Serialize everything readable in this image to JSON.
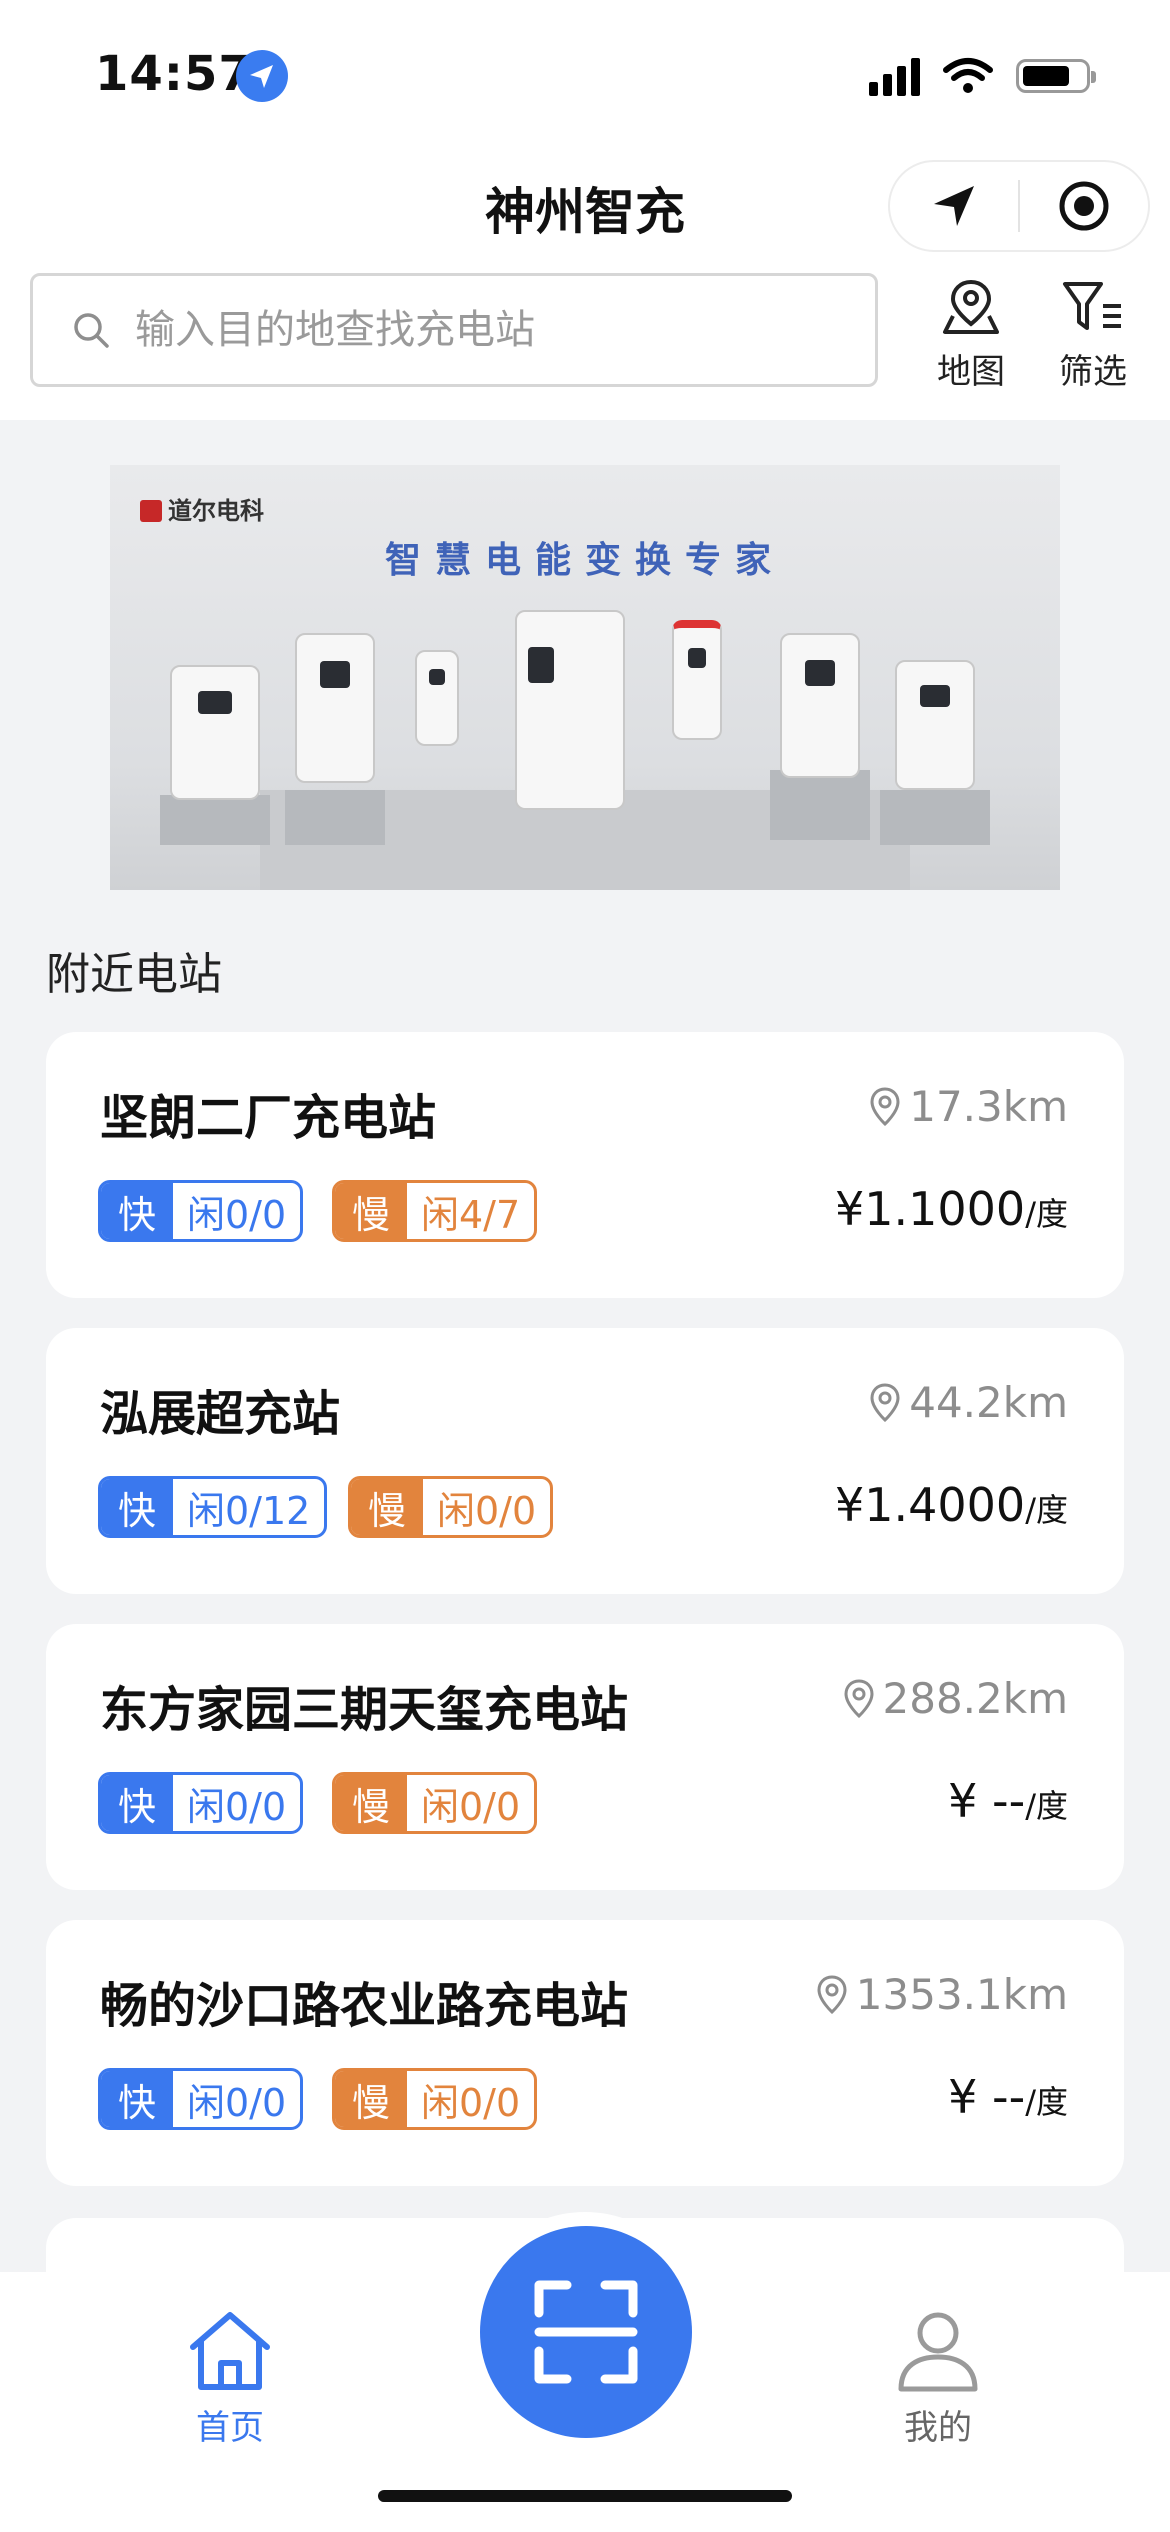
{
  "status_bar": {
    "time": "14:57"
  },
  "header": {
    "title": "神州智充",
    "capsule": {
      "left_icon": "navigation-arrow-icon",
      "right_icon": "target-circle-icon"
    }
  },
  "search": {
    "placeholder": "输入目的地查找充电站",
    "value": ""
  },
  "tools": {
    "map_label": "地图",
    "filter_label": "筛选"
  },
  "banner": {
    "brand": "道尔电科",
    "slogan": "智慧电能变换专家"
  },
  "section_title": "附近电站",
  "stations": [
    {
      "name": "坚朗二厂充电站",
      "distance": "17.3km",
      "fast_key": "快",
      "fast_value": "闲0/0",
      "slow_key": "慢",
      "slow_value": "闲4/7",
      "price": "¥1.1000",
      "unit": "/度"
    },
    {
      "name": "泓展超充站",
      "distance": "44.2km",
      "fast_key": "快",
      "fast_value": "闲0/12",
      "slow_key": "慢",
      "slow_value": "闲0/0",
      "price": "¥1.4000",
      "unit": "/度"
    },
    {
      "name": "东方家园三期天玺充电站",
      "distance": "288.2km",
      "fast_key": "快",
      "fast_value": "闲0/0",
      "slow_key": "慢",
      "slow_value": "闲0/0",
      "price": "¥ --",
      "unit": "/度"
    },
    {
      "name": "畅的沙口路农业路充电站",
      "distance": "1353.1km",
      "fast_key": "快",
      "fast_value": "闲0/0",
      "slow_key": "慢",
      "slow_value": "闲0/0",
      "price": "¥ --",
      "unit": "/度"
    }
  ],
  "tabbar": {
    "home_label": "首页",
    "mine_label": "我的"
  },
  "colors": {
    "accent": "#3a78ee",
    "slow": "#e2843d",
    "background": "#f2f3f5"
  }
}
